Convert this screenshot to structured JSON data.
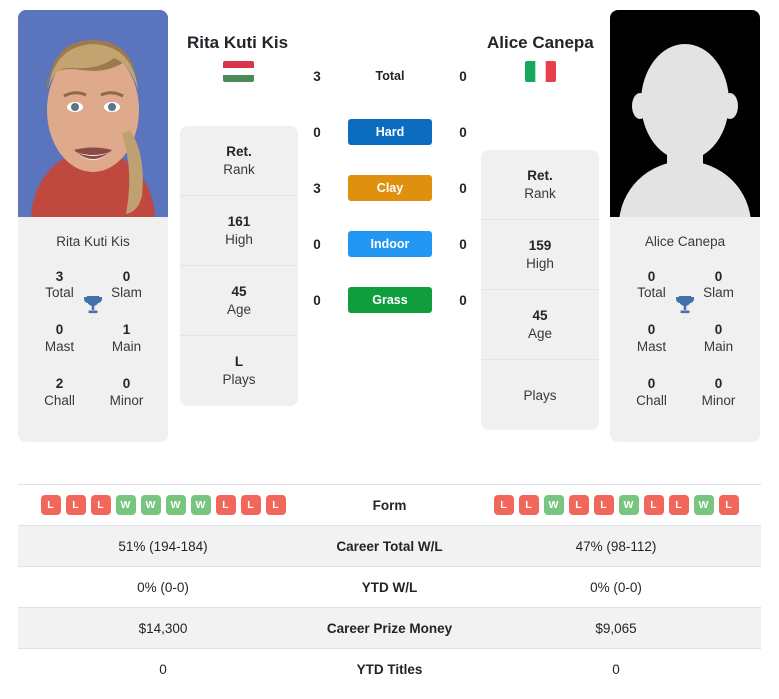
{
  "players": {
    "left": {
      "name": "Rita Kuti Kis",
      "flag_name": "hungary-flag",
      "flag_colors": [
        "#d9344a",
        "#ffffff",
        "#4c8b57"
      ],
      "photo_name": "player-photo-rita-kuti-kis",
      "card_name": "Rita Kuti Kis",
      "titles": [
        {
          "value": "3",
          "label": "Total"
        },
        {
          "value": "0",
          "label": "Slam"
        },
        {
          "value": "0",
          "label": "Mast"
        },
        {
          "value": "1",
          "label": "Main"
        },
        {
          "value": "2",
          "label": "Chall"
        },
        {
          "value": "0",
          "label": "Minor"
        }
      ],
      "rank_rows": [
        {
          "value": "Ret.",
          "label": "Rank"
        },
        {
          "value": "161",
          "label": "High"
        },
        {
          "value": "45",
          "label": "Age"
        },
        {
          "value": "L",
          "label": "Plays"
        }
      ],
      "form": [
        "L",
        "L",
        "L",
        "W",
        "W",
        "W",
        "W",
        "L",
        "L",
        "L"
      ],
      "career_total_wl": "51% (194-184)",
      "ytd_wl": "0% (0-0)",
      "career_prize_money": "$14,300",
      "ytd_titles": "0"
    },
    "right": {
      "name": "Alice Canepa",
      "flag_name": "italy-flag",
      "flag_colors": [
        "#17a85a",
        "#ffffff",
        "#ea3d4e"
      ],
      "photo_name": "player-photo-alice-canepa",
      "card_name": "Alice Canepa",
      "titles": [
        {
          "value": "0",
          "label": "Total"
        },
        {
          "value": "0",
          "label": "Slam"
        },
        {
          "value": "0",
          "label": "Mast"
        },
        {
          "value": "0",
          "label": "Main"
        },
        {
          "value": "0",
          "label": "Chall"
        },
        {
          "value": "0",
          "label": "Minor"
        }
      ],
      "rank_rows": [
        {
          "value": "Ret.",
          "label": "Rank"
        },
        {
          "value": "159",
          "label": "High"
        },
        {
          "value": "45",
          "label": "Age"
        },
        {
          "value": "",
          "label": "Plays"
        }
      ],
      "form": [
        "L",
        "L",
        "W",
        "L",
        "L",
        "W",
        "L",
        "L",
        "W",
        "L"
      ],
      "career_total_wl": "47% (98-112)",
      "ytd_wl": "0% (0-0)",
      "career_prize_money": "$9,065",
      "ytd_titles": "0"
    }
  },
  "surfaces": [
    {
      "label": "Total",
      "left": "3",
      "right": "0",
      "color": "",
      "plain": true
    },
    {
      "label": "Hard",
      "left": "0",
      "right": "0",
      "color": "#0b6cc0",
      "plain": false
    },
    {
      "label": "Clay",
      "left": "3",
      "right": "0",
      "color": "#e0900f",
      "plain": false
    },
    {
      "label": "Indoor",
      "left": "0",
      "right": "0",
      "color": "#2196f3",
      "plain": false
    },
    {
      "label": "Grass",
      "left": "0",
      "right": "0",
      "color": "#0f9d3e",
      "plain": false
    }
  ],
  "table_rows": [
    {
      "label": "Form",
      "key": "form",
      "type": "form",
      "striped": false
    },
    {
      "label": "Career Total W/L",
      "key": "career_total_wl",
      "type": "text",
      "striped": true
    },
    {
      "label": "YTD W/L",
      "key": "ytd_wl",
      "type": "text",
      "striped": false
    },
    {
      "label": "Career Prize Money",
      "key": "career_prize_money",
      "type": "text",
      "striped": true
    },
    {
      "label": "YTD Titles",
      "key": "ytd_titles",
      "type": "text",
      "striped": false
    }
  ],
  "icons": {
    "trophy": "trophy-icon",
    "trophy_color": "#4472a8"
  }
}
